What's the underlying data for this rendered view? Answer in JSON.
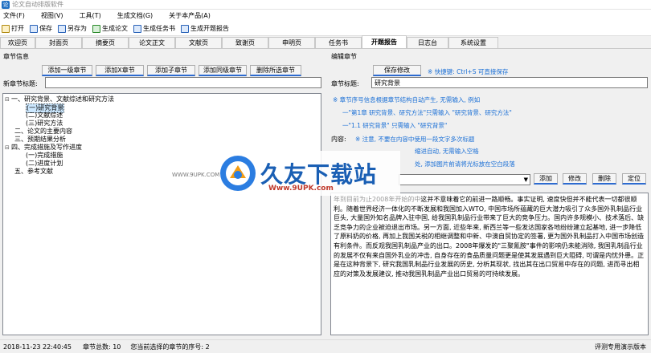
{
  "window": {
    "title": "论文自动排版软件"
  },
  "menu": [
    "文件(F)",
    "视图(V)",
    "工具(T)",
    "生成文档(G)",
    "关于本产品(A)"
  ],
  "toolbar": [
    "打开",
    "保存",
    "另存为",
    "生成论文",
    "生成任务书",
    "生成开题报告"
  ],
  "tabs": [
    "欢迎页",
    "封面页",
    "摘要页",
    "论文正文",
    "文献页",
    "致谢页",
    "申明页",
    "任务书",
    "开题报告",
    "日志台",
    "系统设置"
  ],
  "active_tab": "开题报告",
  "left": {
    "title": "章节信息",
    "buttons": [
      "添加一级章节",
      "添加X章节",
      "添加子章节",
      "添加同级章节",
      "删除所选章节"
    ],
    "new_label": "新章节标题:",
    "tree": [
      {
        "toggle": "⊟",
        "text": "一、研究背景、文献综述和研究方法"
      },
      {
        "toggle": "",
        "text": "(一)研究背景"
      },
      {
        "toggle": "",
        "text": "(二)文献综述"
      },
      {
        "toggle": "",
        "text": "(三)研究方法"
      },
      {
        "toggle": "",
        "text": "二、论文的主要内容"
      },
      {
        "toggle": "",
        "text": "三、预期结果分析"
      },
      {
        "toggle": "⊟",
        "text": "四、完成措施及写作进度"
      },
      {
        "toggle": "",
        "text": "(一)完成措施"
      },
      {
        "toggle": "",
        "text": "(二)进度计划"
      },
      {
        "toggle": "",
        "text": "五、参考文献"
      }
    ]
  },
  "right": {
    "title": "编辑章节",
    "save_btn": "保存修改",
    "shortcut_hint": "※ 快捷键: Ctrl+S 可直接保存",
    "title_label": "章节标题:",
    "title_value": "研究背景",
    "hints": [
      "※ 章节序号信息根据章节结构自动产生, 无需输入, 例如",
      "一\"第1章 研究背景、研究方法\"只需输入 \"研究背景、研究方法\"",
      "一\"1.1 研究背景\" 只需输入 \"研究背景\"",
      "缩进自动, 无需输入空格",
      "处, 添加图片前请将光标放在空白段落"
    ],
    "hint_prefix_1": "内容:",
    "hint_frag_1": "※ 注意, 不要在内容中使用一段文字多次标题",
    "action_buttons": [
      "添加",
      "修改",
      "删除",
      "定位"
    ],
    "content": "这并不意味着它的前进一路顺畅。事实证明, 速度快但并不能代表一切都很顺利。随着世界经济一体化的不断发展和我国加入WTO, 中国市场所蕴藏的巨大潜力吸引了众多国外乳制品行业巨头, 大量国外知名品牌入驻中国, 给我国乳制品行业带来了巨大的竞争压力。国内许多规模小、技术落后、缺乏竞争力的企业被迫退出市场。另一方面, 近些年来, 新西兰等一些发达国家各地纷纷建立起基地, 进一步降低了原料奶的价格, 再加上我国关税的相继调整和中新、中澳自贸协定的签署, 更为国外乳制品打入中国市场创造有利条件。而反观我国乳制品产业的出口。2008年爆发的\"三聚氰胺\"事件的影响仍未能消除, 我国乳制品行业的发展不仅有来自国外乳业的冲击, 自身存在的食品质量问题更是使其发展遇到巨大阻碍, 可谓是内忧外患。正是在这种背景下, 研究我国乳制品行业发展的历史, 分析其现状, 找出其在出口贸易中存在的问题, 进而寻出相应的对策及发展建议, 推动我国乳制品产业出口贸易的可持续发展。",
    "content_prefix": "年到目前为止2008年开始的",
    "content_prefix2": "中"
  },
  "watermark": {
    "brand": "久友下载站",
    "url": "Www.9UPK.com",
    "left_url": "WWW.9UPK.COM"
  },
  "status": {
    "time": "2018-11-23 22:40:45",
    "count": "章节总数: 10",
    "seq": "您当前选择的章节的序号: 2",
    "edition": "评测专用演示版本"
  }
}
